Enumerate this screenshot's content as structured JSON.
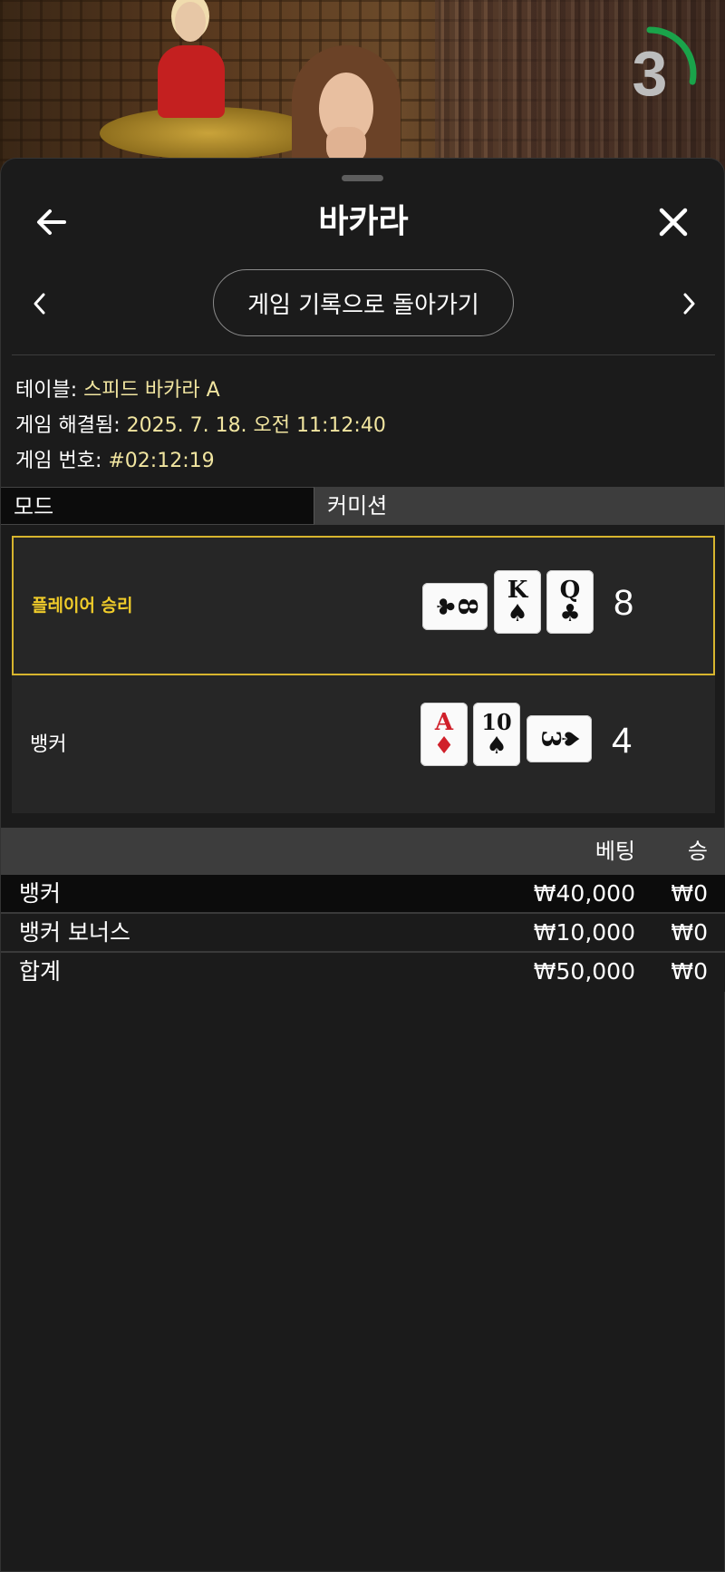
{
  "timer": {
    "value": "3",
    "progress": 0.28,
    "accent": "#1aa34a"
  },
  "header": {
    "title": "바카라"
  },
  "nav": {
    "history_label": "게임 기록으로 돌아가기"
  },
  "info": {
    "table_label": "테이블:",
    "table_value": "스피드 바카라 A",
    "resolved_label": "게임 해결됨:",
    "resolved_value": "2025. 7. 18. 오전 11:12:40",
    "number_label": "게임 번호:",
    "number_value": "#02:12:19"
  },
  "tabs": {
    "mode": "모드",
    "commission": "커미션"
  },
  "result": {
    "player": {
      "label": "플레이어 승리",
      "score": "8",
      "cards": [
        {
          "rank": "8",
          "suit": "♣",
          "color": "black",
          "orientation": "sideways"
        },
        {
          "rank": "K",
          "suit": "♠",
          "color": "black",
          "orientation": "upright"
        },
        {
          "rank": "Q",
          "suit": "♣",
          "color": "black",
          "orientation": "upright"
        }
      ]
    },
    "banker": {
      "label": "뱅커",
      "score": "4",
      "cards": [
        {
          "rank": "A",
          "suit": "♦",
          "color": "red",
          "orientation": "upright"
        },
        {
          "rank": "10",
          "suit": "♠",
          "color": "black",
          "orientation": "upright"
        },
        {
          "rank": "3",
          "suit": "♠",
          "color": "black",
          "orientation": "sideways"
        }
      ]
    },
    "win_color": "#d7b52e"
  },
  "bets": {
    "headers": {
      "bet": "베팅",
      "win": "승"
    },
    "rows": [
      {
        "name": "뱅커",
        "bet": "₩40,000",
        "win": "₩0"
      },
      {
        "name": "뱅커 보너스",
        "bet": "₩10,000",
        "win": "₩0"
      },
      {
        "name": "합계",
        "bet": "₩50,000",
        "win": "₩0"
      }
    ]
  }
}
